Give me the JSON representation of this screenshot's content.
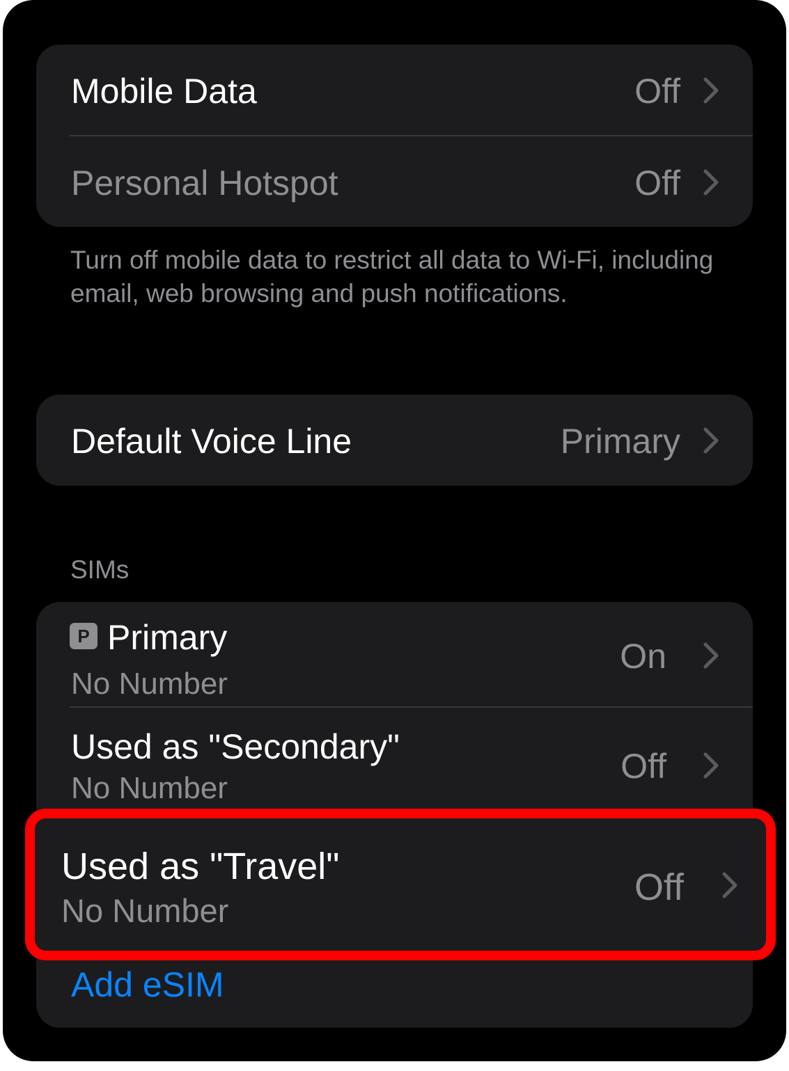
{
  "cellular": {
    "mobile_data": {
      "label": "Mobile Data",
      "value": "Off"
    },
    "personal_hotspot": {
      "label": "Personal Hotspot",
      "value": "Off"
    },
    "footer": "Turn off mobile data to restrict all data to Wi-Fi, including email, web browsing and push notifications."
  },
  "voice": {
    "default_voice_line": {
      "label": "Default Voice Line",
      "value": "Primary"
    }
  },
  "sims": {
    "header": "SIMs",
    "items": [
      {
        "badge": "P",
        "label": "Primary",
        "subtitle": "No Number",
        "value": "On"
      },
      {
        "label": "Used as \"Secondary\"",
        "subtitle": "No Number",
        "value": "Off"
      },
      {
        "label": "Used as \"Travel\"",
        "subtitle": "No Number",
        "value": "Off",
        "highlighted": true
      }
    ],
    "add_esim": "Add eSIM"
  },
  "colors": {
    "background": "#000000",
    "group": "#1c1c1e",
    "secondary_text": "#8e8e93",
    "link": "#0a84ff",
    "highlight_border": "#ff0000"
  },
  "icons": {
    "chevron": "chevron-right-icon",
    "primary_badge": "primary-sim-badge-icon"
  }
}
